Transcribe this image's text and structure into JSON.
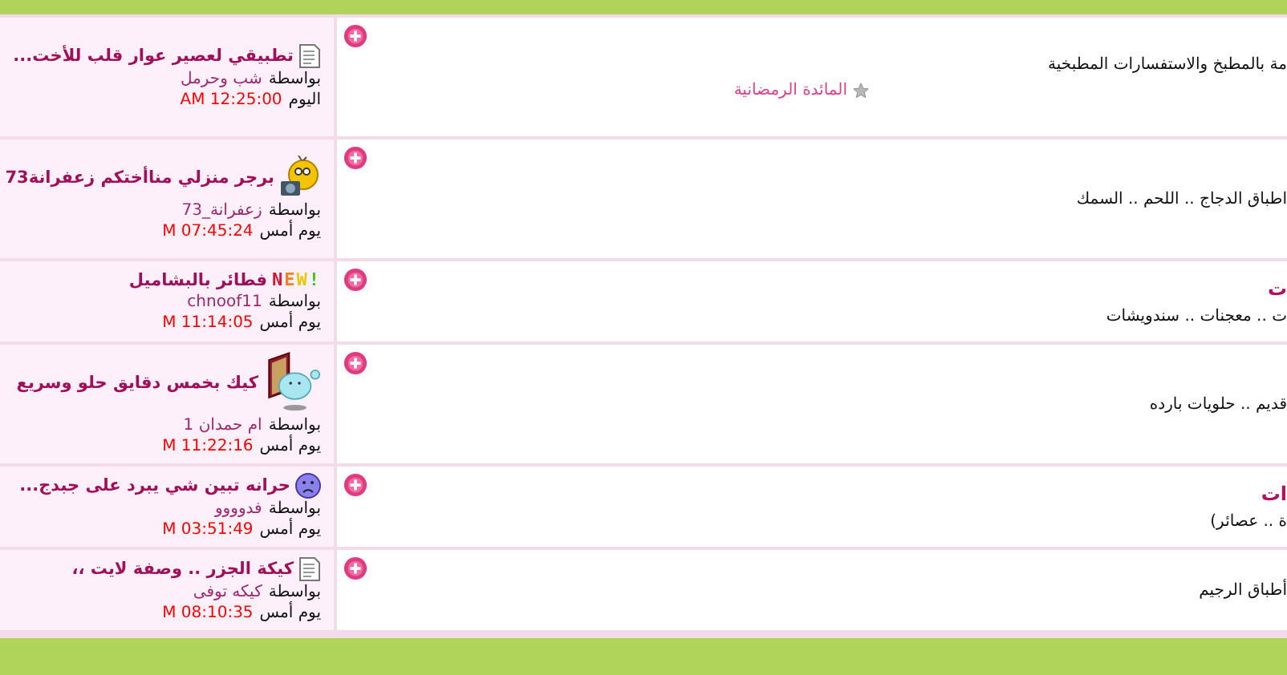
{
  "forums": [
    {
      "description": "مة بالمطبخ والاستفسارات المطبخية",
      "subforums": [
        "المائدة الرمضانية"
      ],
      "last_post": {
        "kind": "document",
        "title": "تطبيقي لعصير عوار قلب للأخت...",
        "by_label": "بواسطة",
        "author": "شب وحرمل",
        "day": "اليوم",
        "time": "AM 12:25:00"
      }
    },
    {
      "description": "اطباق الدجاج .. اللحم .. السمك",
      "last_post": {
        "kind": "smiley",
        "title": "برجر منزلي مناأختكم زعفرانة73",
        "by_label": "بواسطة",
        "author": "زعفرانة_73",
        "day": "يوم أمس",
        "time": "M 07:45:24"
      }
    },
    {
      "title": "ت",
      "description": "ت .. معجنات .. سندويشات",
      "last_post": {
        "kind": "badge",
        "badge": "NEW!",
        "title": "فطائر بالبشاميل",
        "by_label": "بواسطة",
        "author": "chnoof11",
        "day": "يوم أمس",
        "time": "M 11:14:05"
      }
    },
    {
      "description": "قديم .. حلويات بارده",
      "last_post": {
        "kind": "book",
        "title": "كيك بخمس دقايق حلو وسريع",
        "by_label": "بواسطة",
        "author": "ام حمدان 1",
        "day": "يوم أمس",
        "time": "M 11:22:16"
      }
    },
    {
      "title": "ات",
      "description": "ة .. عصائر)",
      "last_post": {
        "kind": "sad",
        "title": "حرانه تبين شي يبرد على جبدج...",
        "by_label": "بواسطة",
        "author": "فدوووو",
        "day": "يوم أمس",
        "time": "M 03:51:49"
      }
    },
    {
      "description": "أطباق الرجيم",
      "last_post": {
        "kind": "document",
        "title": "كيكة الجزر .. وصفة لايت ،،",
        "by_label": "بواسطة",
        "author": "كيكه توفى",
        "day": "يوم أمس",
        "time": "M 08:10:35"
      }
    }
  ]
}
